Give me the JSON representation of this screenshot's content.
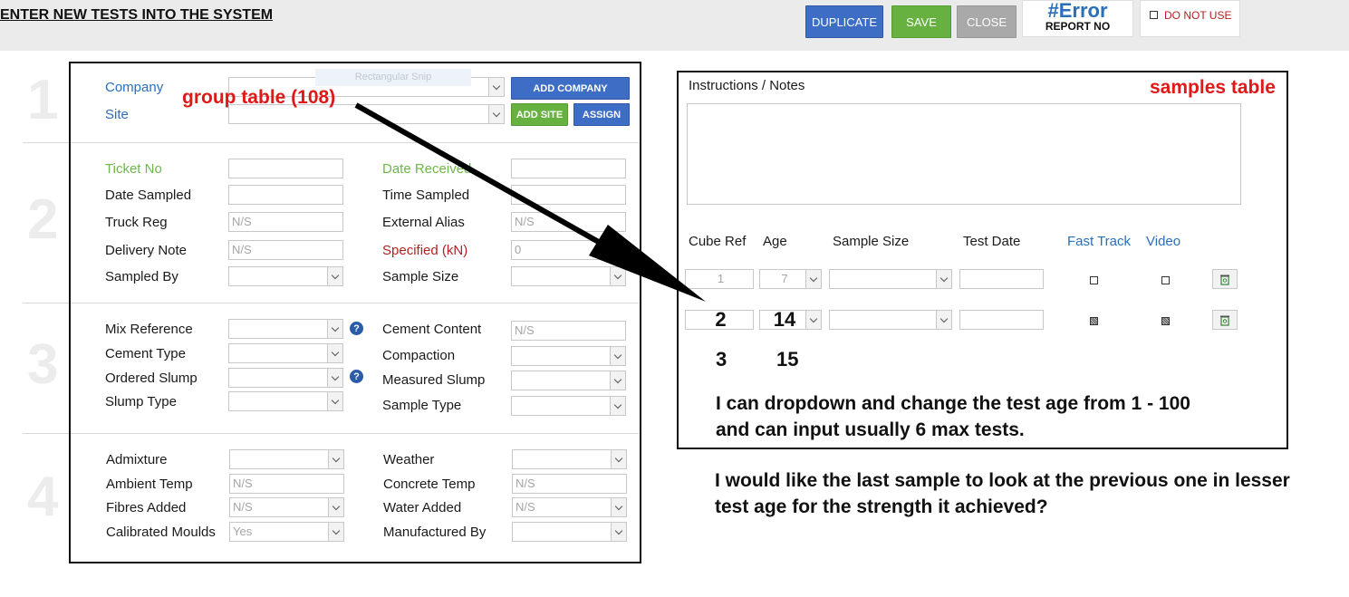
{
  "header": {
    "title": "ENTER NEW TESTS INTO THE SYSTEM",
    "buttons": {
      "duplicate": "DUPLICATE",
      "save": "SAVE",
      "close": "CLOSE"
    },
    "report": {
      "error": "#Error",
      "label": "REPORT NO"
    },
    "do_not_use": "DO NOT USE"
  },
  "sections": {
    "n1": "1",
    "n2": "2",
    "n3": "3",
    "n4": "4"
  },
  "section1": {
    "company_label": "Company",
    "site_label": "Site",
    "add_company": "ADD COMPANY",
    "add_site": "ADD SITE",
    "assign": "ASSIGN",
    "ghost_text": "Rectangular Snip"
  },
  "section2": {
    "ticket_no": "Ticket No",
    "date_received": "Date Received",
    "date_sampled": "Date Sampled",
    "time_sampled": "Time Sampled",
    "truck_reg": "Truck Reg",
    "truck_reg_value": "N/S",
    "external_alias": "External Alias",
    "external_alias_value": "N/S",
    "delivery_note": "Delivery Note",
    "delivery_note_value": "N/S",
    "specified": "Specified (kN)",
    "specified_value": "0",
    "sampled_by": "Sampled By",
    "sample_size": "Sample Size"
  },
  "section3": {
    "mix_reference": "Mix Reference",
    "cement_content": "Cement Content",
    "cement_content_value": "N/S",
    "cement_type": "Cement Type",
    "compaction": "Compaction",
    "ordered_slump": "Ordered Slump",
    "measured_slump": "Measured Slump",
    "slump_type": "Slump Type",
    "sample_type": "Sample Type",
    "help_glyph": "?"
  },
  "section4": {
    "admixture": "Admixture",
    "weather": "Weather",
    "ambient_temp": "Ambient Temp",
    "ambient_temp_value": "N/S",
    "concrete_temp": "Concrete Temp",
    "concrete_temp_value": "N/S",
    "fibres_added": "Fibres Added",
    "fibres_added_value": "N/S",
    "water_added": "Water Added",
    "water_added_value": "N/S",
    "calibrated_moulds": "Calibrated Moulds",
    "calibrated_moulds_value": "Yes",
    "manufactured_by": "Manufactured By"
  },
  "samples": {
    "instructions_label": "Instructions / Notes",
    "headers": {
      "cube_ref": "Cube Ref",
      "age": "Age",
      "sample_size": "Sample Size",
      "test_date": "Test Date",
      "fast_track": "Fast Track",
      "video": "Video"
    },
    "rows": [
      {
        "cube_ref": "1",
        "age": "7"
      },
      {
        "cube_ref": "2",
        "age": "14"
      },
      {
        "cube_ref": "3",
        "age": "15"
      }
    ]
  },
  "annotations": {
    "group_table": "group table (108)",
    "samples_table": "samples table",
    "note1_line1": "I can dropdown and change the test age from 1 - 100",
    "note1_line2": "and can input usually 6 max tests.",
    "note2_line1": "I would like the last sample to look at the previous one in lesser",
    "note2_line2": "test age for the strength it achieved?"
  },
  "colors": {
    "accent_blue": "#3e6dc6",
    "accent_green": "#66b13f",
    "annotation_red": "#e01818",
    "label_blue": "#2a6fba"
  }
}
